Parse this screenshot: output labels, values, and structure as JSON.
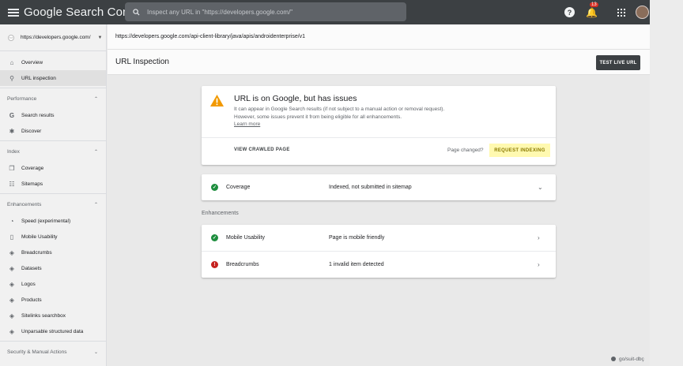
{
  "topbar": {
    "logo": "Google Search Console",
    "search_placeholder": "Inspect any URL in \"https://developers.google.com/\"",
    "notification_count": "13"
  },
  "sidebar": {
    "property": "https://developers.google.com/",
    "items": [
      {
        "label": "Overview",
        "icon": "home-icon"
      },
      {
        "label": "URL inspection",
        "icon": "search-icon",
        "active": true
      }
    ],
    "sections": [
      {
        "title": "Performance",
        "items": [
          {
            "label": "Search results",
            "icon": "google-g-icon"
          },
          {
            "label": "Discover",
            "icon": "asterisk-icon"
          }
        ]
      },
      {
        "title": "Index",
        "items": [
          {
            "label": "Coverage",
            "icon": "file-copy-icon"
          },
          {
            "label": "Sitemaps",
            "icon": "sitemap-icon"
          }
        ]
      },
      {
        "title": "Enhancements",
        "items": [
          {
            "label": "Speed (experimental)",
            "icon": "speedometer-icon"
          },
          {
            "label": "Mobile Usability",
            "icon": "phone-icon"
          },
          {
            "label": "Breadcrumbs",
            "icon": "layers-icon"
          },
          {
            "label": "Datasets",
            "icon": "layers-icon"
          },
          {
            "label": "Logos",
            "icon": "layers-icon"
          },
          {
            "label": "Products",
            "icon": "layers-icon"
          },
          {
            "label": "Sitelinks searchbox",
            "icon": "layers-icon"
          },
          {
            "label": "Unparsable structured data",
            "icon": "layers-icon"
          }
        ]
      },
      {
        "title": "Security & Manual Actions",
        "items": []
      }
    ]
  },
  "main": {
    "inspected_url": "https://developers.google.com/api-client-library/java/apis/androidenterprise/v1",
    "page_title": "URL Inspection",
    "test_live_button": "TEST LIVE URL",
    "status_card": {
      "title": "URL is on Google, but has issues",
      "description": "It can appear in Google Search results (if not subject to a manual action or removal request). However, some issues prevent it from being eligible for all enhancements.",
      "learn_more": "Learn more",
      "view_crawled": "VIEW CRAWLED PAGE",
      "page_changed": "Page changed?",
      "request_indexing": "REQUEST INDEXING"
    },
    "coverage": {
      "name": "Coverage",
      "value": "Indexed, not submitted in sitemap",
      "status": "ok"
    },
    "enhancements_label": "Enhancements",
    "enhancements": [
      {
        "name": "Mobile Usability",
        "value": "Page is mobile friendly",
        "status": "ok"
      },
      {
        "name": "Breadcrumbs",
        "value": "1 invalid item detected",
        "status": "error"
      }
    ]
  },
  "footer_link": "go/suit-dbç",
  "colors": {
    "topbar": "#3c4043",
    "success": "#1e8e3e",
    "error": "#c5221f",
    "warning": "#f29900",
    "request_highlight": "#fff9b0"
  }
}
